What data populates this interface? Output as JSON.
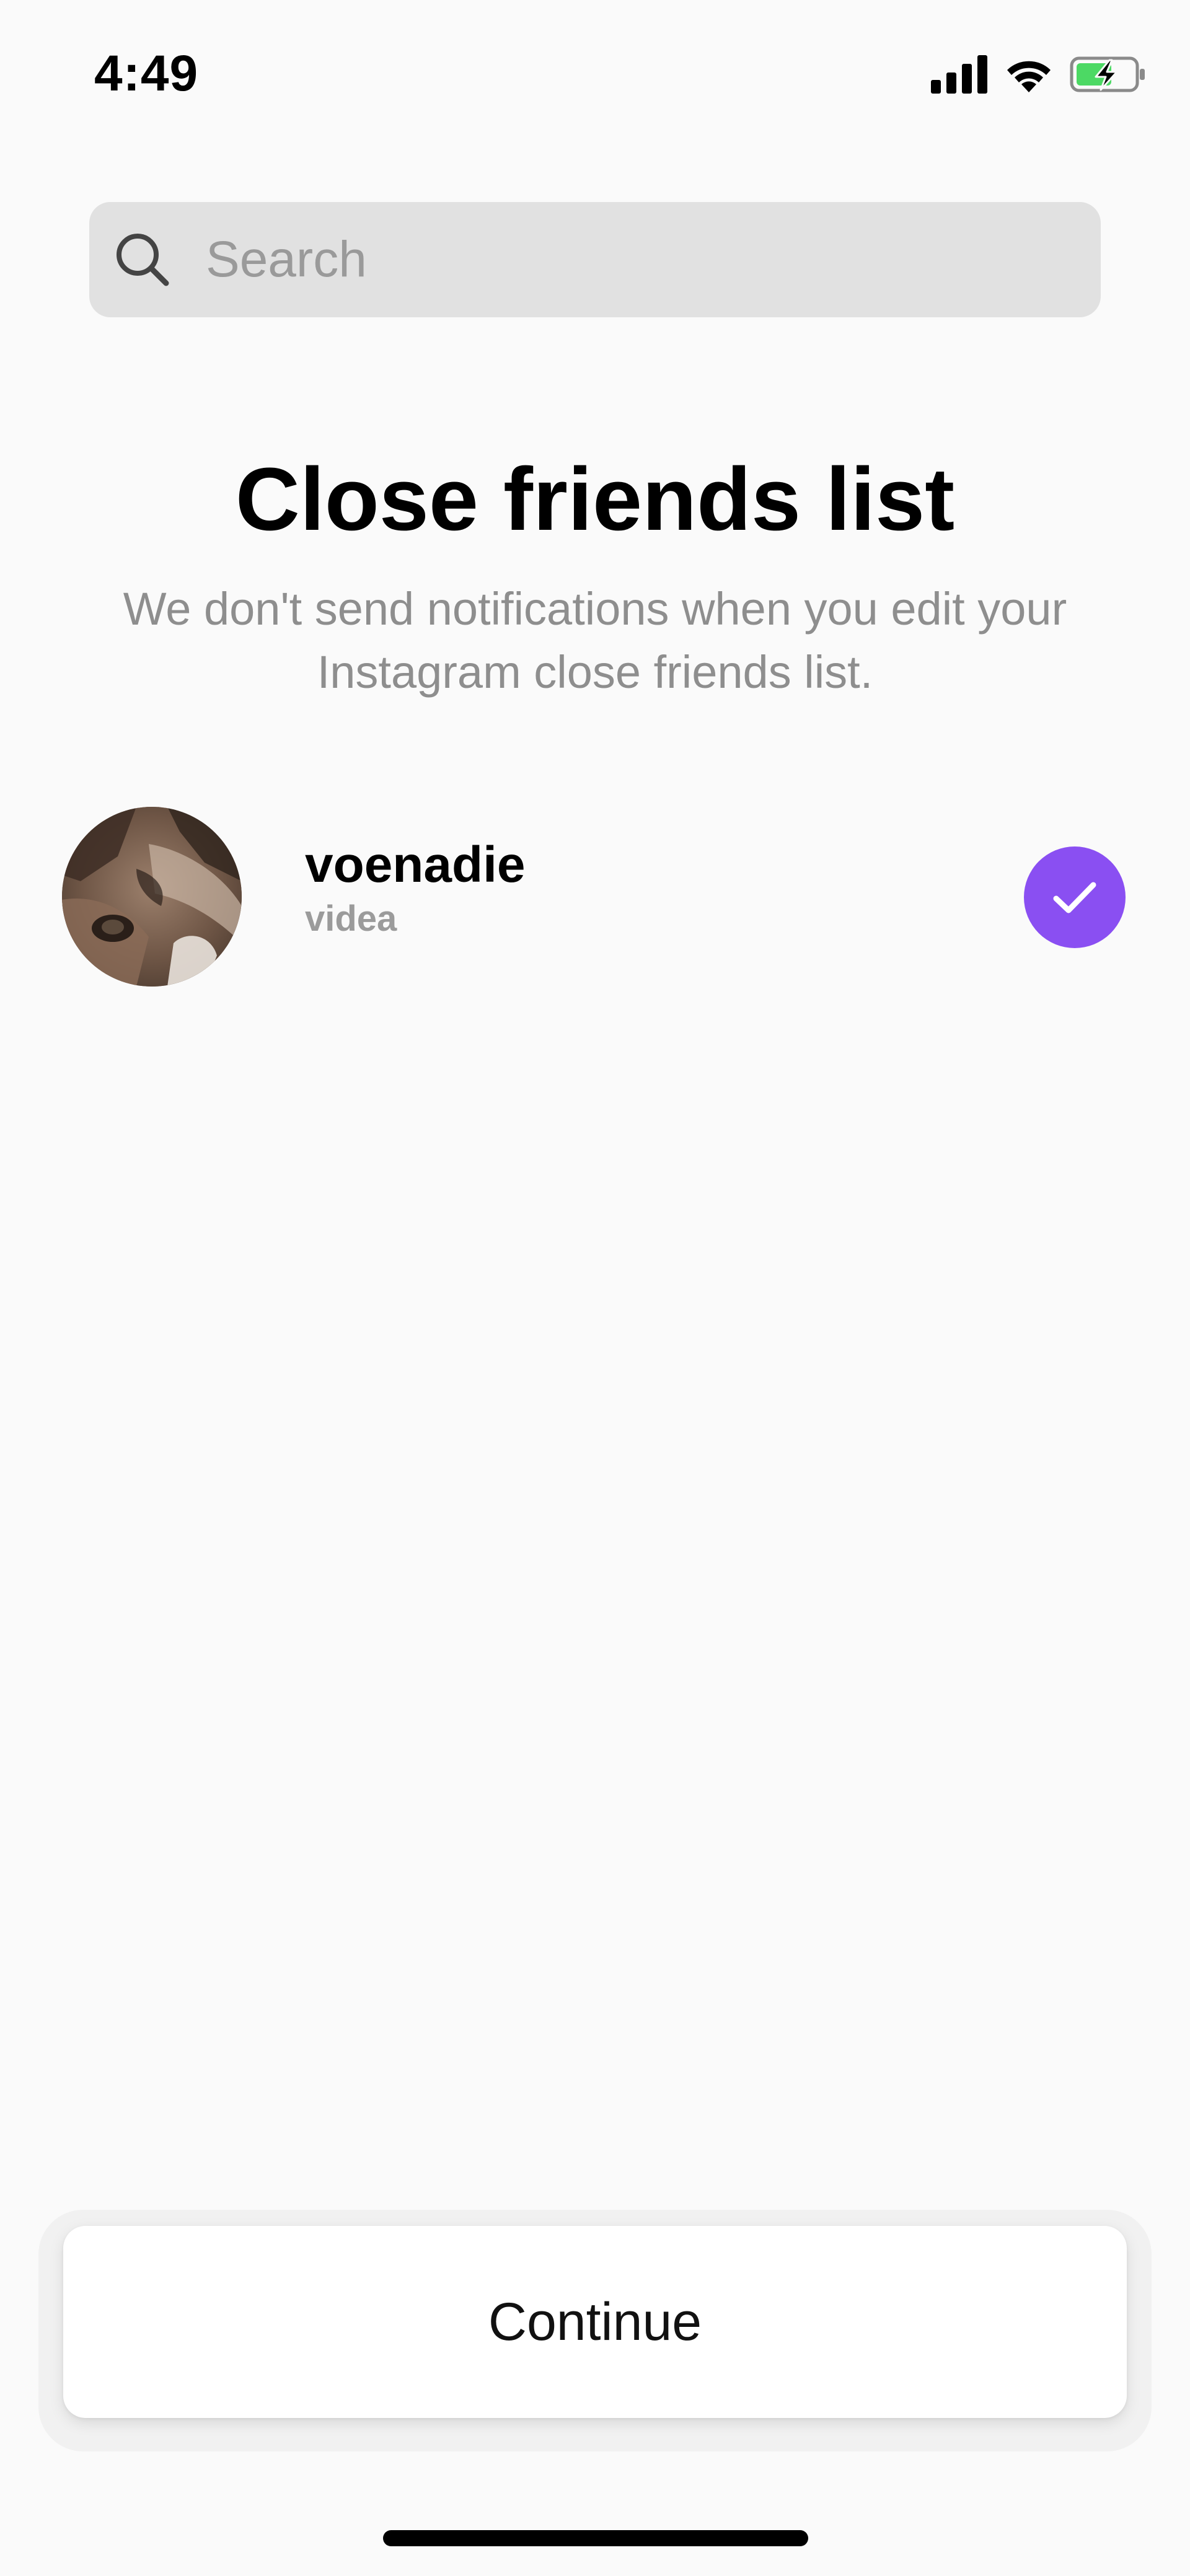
{
  "status_bar": {
    "time": "4:49",
    "icons": [
      "cellular-signal-icon",
      "wifi-icon",
      "battery-charging-icon"
    ],
    "battery_color": "#4cd964"
  },
  "search": {
    "placeholder": "Search",
    "value": ""
  },
  "header": {
    "title": "Close friends list",
    "subtitle": "We don't send notifications when you edit your Instagram close friends list."
  },
  "friends": [
    {
      "username": "voenadie",
      "full_name": "videa",
      "selected": true
    }
  ],
  "footer": {
    "continue_label": "Continue"
  },
  "colors": {
    "accent": "#8a4ff2",
    "background": "#fafafa",
    "search_background": "#e1e1e1",
    "secondary_text": "#8e8e8e"
  }
}
